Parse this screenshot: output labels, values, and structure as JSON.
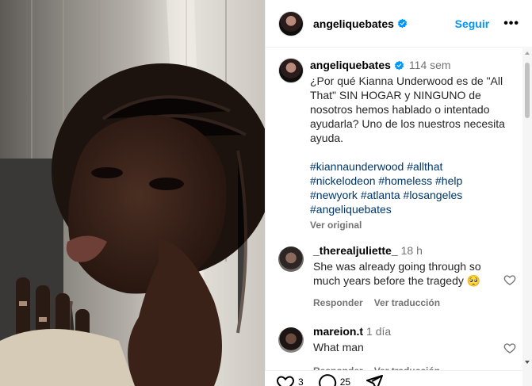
{
  "post": {
    "username": "angeliquebates",
    "follow_label": "Seguir",
    "more_label": "•••",
    "caption_time": "114 sem",
    "caption_text": "¿Por qué Kianna Underwood es de \"All That\" SIN HOGAR y NINGUNO de nosotros hemos hablado o intentado ayudarla? Uno de los nuestros necesita ayuda.",
    "hashtags": [
      "#kiannaunderwood",
      "#allthat",
      "#nickelodeon",
      "#homeless",
      "#help",
      "#newyork",
      "#atlanta",
      "#losangeles",
      "#angeliquebates"
    ],
    "see_original": "Ver original"
  },
  "comments": [
    {
      "user": "_therealjuliette_",
      "time": "18 h",
      "text": "She was already going through so much years before the tragedy 🥺",
      "reply": "Responder",
      "translate": "Ver traducción"
    },
    {
      "user": "mareion.t",
      "time": "1 día",
      "text": "What man",
      "reply": "Responder",
      "translate": "Ver traducción"
    }
  ],
  "bottom_bar": {
    "likes_count": "3",
    "comments_count": "25"
  },
  "colors": {
    "link": "#0095f6",
    "hashtag": "#00376b",
    "muted": "#737373"
  }
}
